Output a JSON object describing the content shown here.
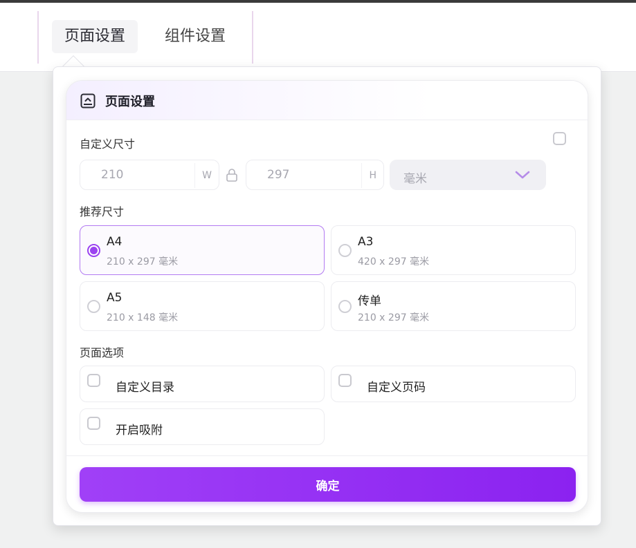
{
  "tabs": [
    {
      "label": "页面设置",
      "active": true
    },
    {
      "label": "组件设置",
      "active": false
    }
  ],
  "panel": {
    "title": "页面设置",
    "icon": "page-collapse-icon"
  },
  "custom_size": {
    "label": "自定义尺寸",
    "width_value": "210",
    "width_suffix": "W",
    "height_value": "297",
    "height_suffix": "H",
    "unit": "毫米",
    "checked": false
  },
  "recommended": {
    "label": "推荐尺寸",
    "items": [
      {
        "name": "A4",
        "desc": "210 x 297 毫米",
        "selected": true
      },
      {
        "name": "A3",
        "desc": "420 x 297 毫米",
        "selected": false
      },
      {
        "name": "A5",
        "desc": "210 x 148 毫米",
        "selected": false
      },
      {
        "name": "传单",
        "desc": "210 x 297 毫米",
        "selected": false
      }
    ]
  },
  "options": {
    "label": "页面选项",
    "items": [
      {
        "label": "自定义目录",
        "checked": false
      },
      {
        "label": "自定义页码",
        "checked": false
      },
      {
        "label": "开启吸附",
        "checked": false
      }
    ]
  },
  "confirm_label": "确定",
  "colors": {
    "accent": "#9b43f0",
    "button_start": "#a040f7",
    "button_end": "#8b22f0"
  }
}
